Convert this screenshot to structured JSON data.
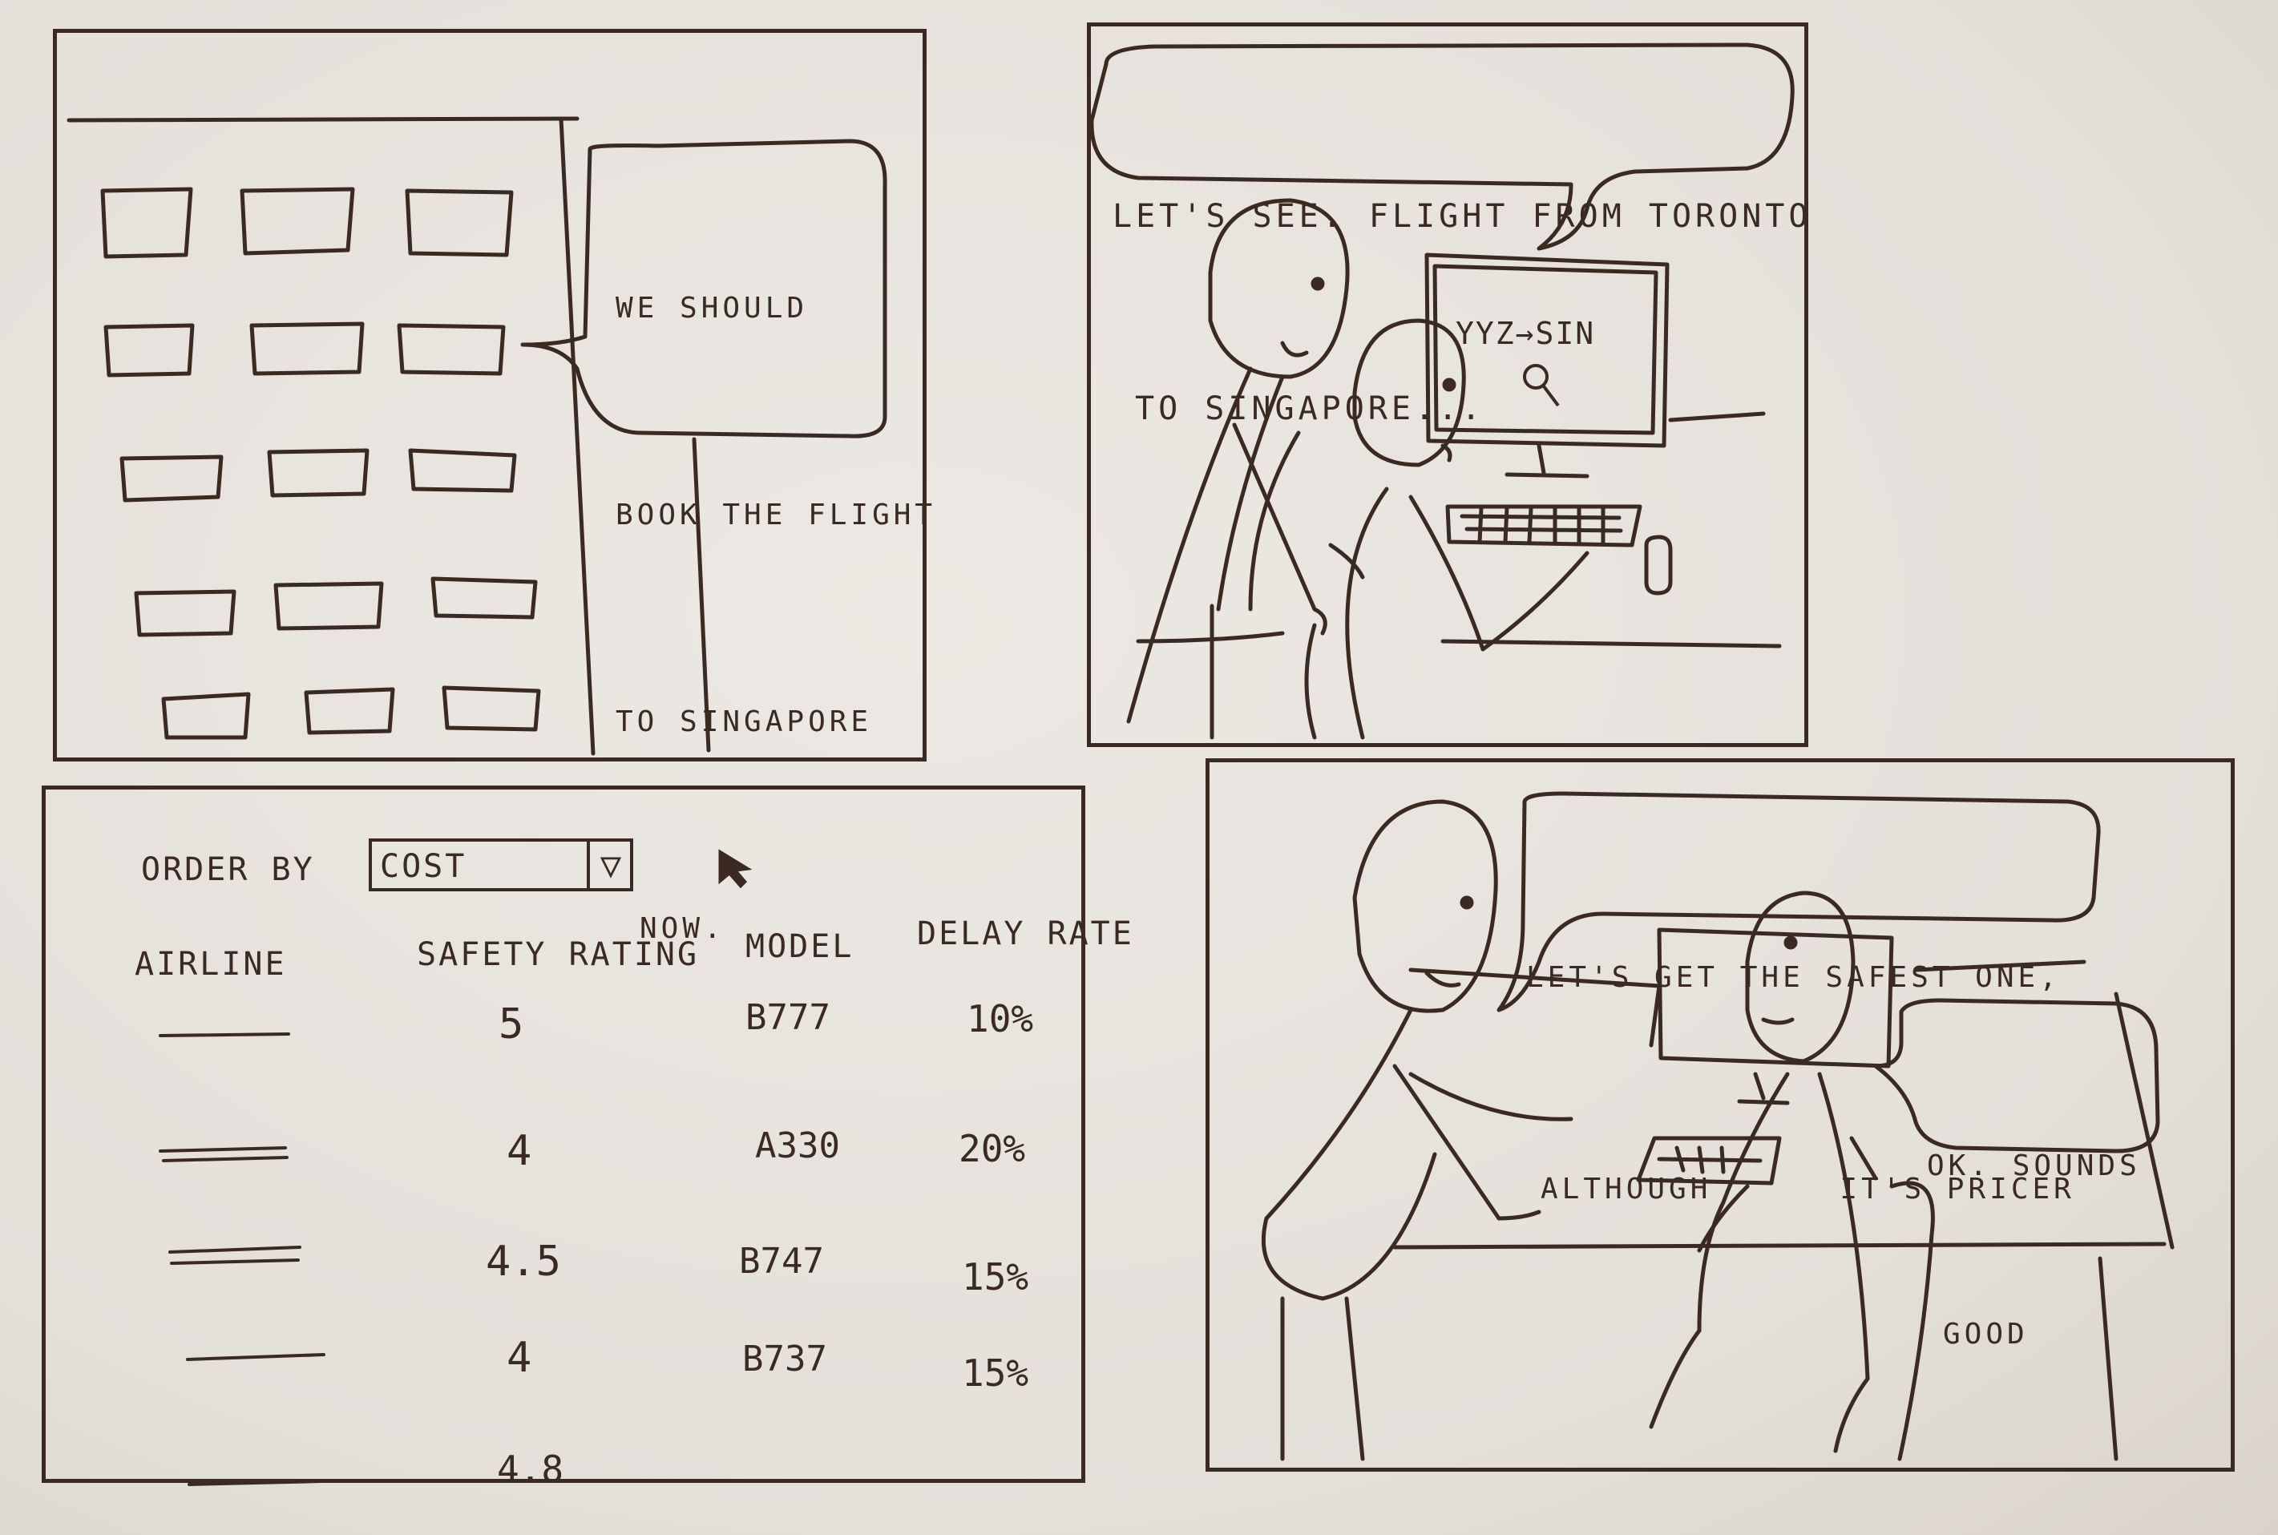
{
  "panels": {
    "panel1": {
      "speech": [
        "WE SHOULD",
        "BOOK THE FLIGHT",
        "TO SINGAPORE",
        "NOW."
      ]
    },
    "panel2": {
      "speech": [
        "LET'S SEE. FLIGHT FROM TORONTO",
        "TO SINGAPORE..."
      ],
      "monitor_text": "YYZ→SIN",
      "monitor_icon": "search-icon"
    },
    "panel3": {
      "order_by_label": "ORDER BY",
      "order_by_value": "COST",
      "dropdown_icon": "dropdown-arrow-icon",
      "cursor_icon": "mouse-cursor-icon",
      "columns": [
        "AIRLINE",
        "SAFETY RATING",
        "MODEL",
        "DELAY RATE"
      ],
      "rows": [
        {
          "safety": "5",
          "model": "B777",
          "delay": "10%"
        },
        {
          "safety": "4",
          "model": "A330",
          "delay": "20%"
        },
        {
          "safety": "4.5",
          "model": "B747",
          "delay": "15%"
        },
        {
          "safety": "4",
          "model": "B737",
          "delay": "15%"
        },
        {
          "safety": "4.8",
          "model": "",
          "delay": ""
        }
      ]
    },
    "panel4": {
      "speech_left": [
        "LET'S GET THE SAFEST ONE,",
        "ALTHOUGH      IT'S PRICER"
      ],
      "speech_right": [
        "OK. SOUNDS",
        "GOOD"
      ]
    }
  }
}
